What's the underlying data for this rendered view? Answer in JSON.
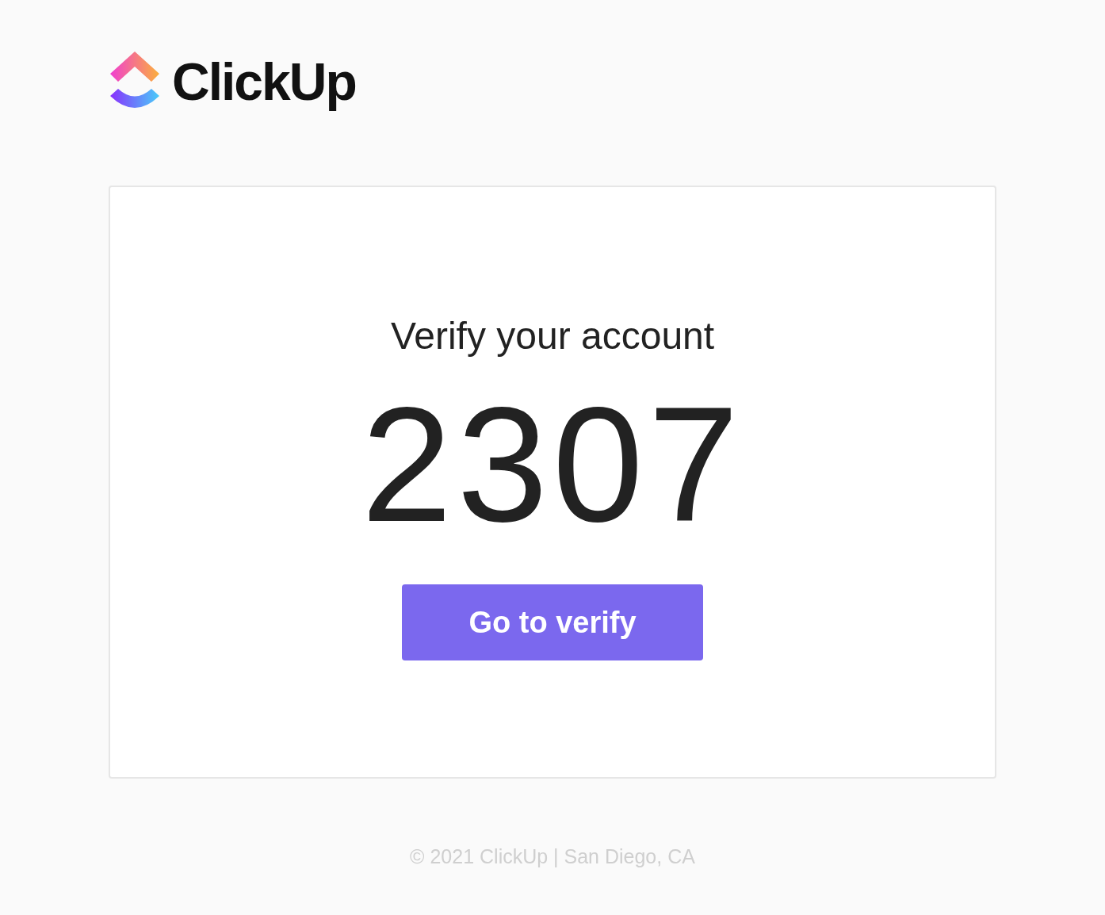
{
  "brand": {
    "name": "ClickUp"
  },
  "card": {
    "title": "Verify your account",
    "code": "2307",
    "button": "Go to verify"
  },
  "footer": "© 2021 ClickUp | San Diego, CA"
}
